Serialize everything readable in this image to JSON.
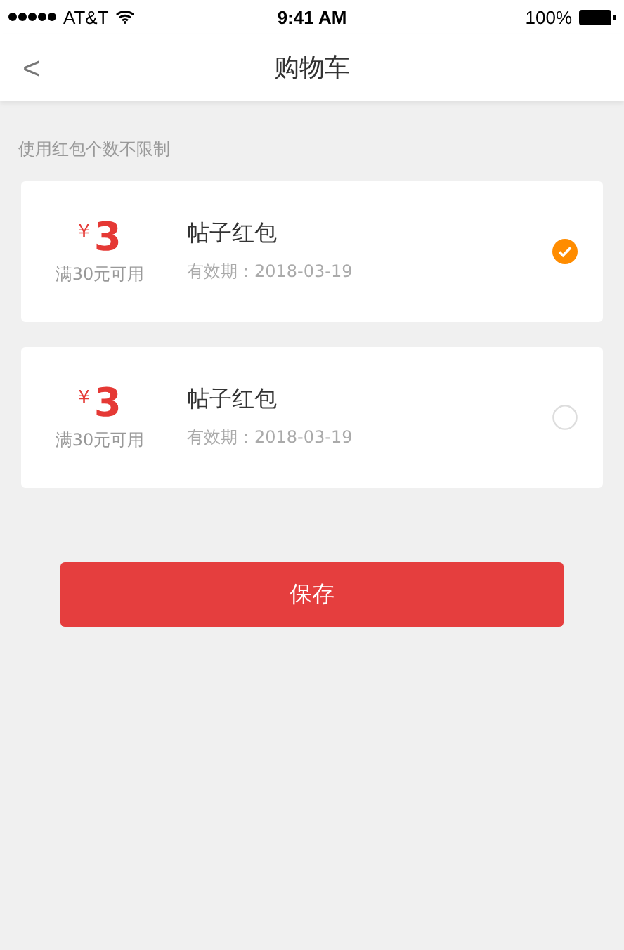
{
  "status_bar": {
    "carrier": "AT&T",
    "time": "9:41 AM",
    "battery": "100%"
  },
  "nav": {
    "back": "<",
    "title": "购物车"
  },
  "note": "使用红包个数不限制",
  "coupons": [
    {
      "currency": "¥",
      "amount": "3",
      "condition": "满30元可用",
      "name": "帖子红包",
      "validity": "有效期：2018-03-19",
      "selected": true
    },
    {
      "currency": "¥",
      "amount": "3",
      "condition": "满30元可用",
      "name": "帖子红包",
      "validity": "有效期：2018-03-19",
      "selected": false
    }
  ],
  "save_button": "保存"
}
